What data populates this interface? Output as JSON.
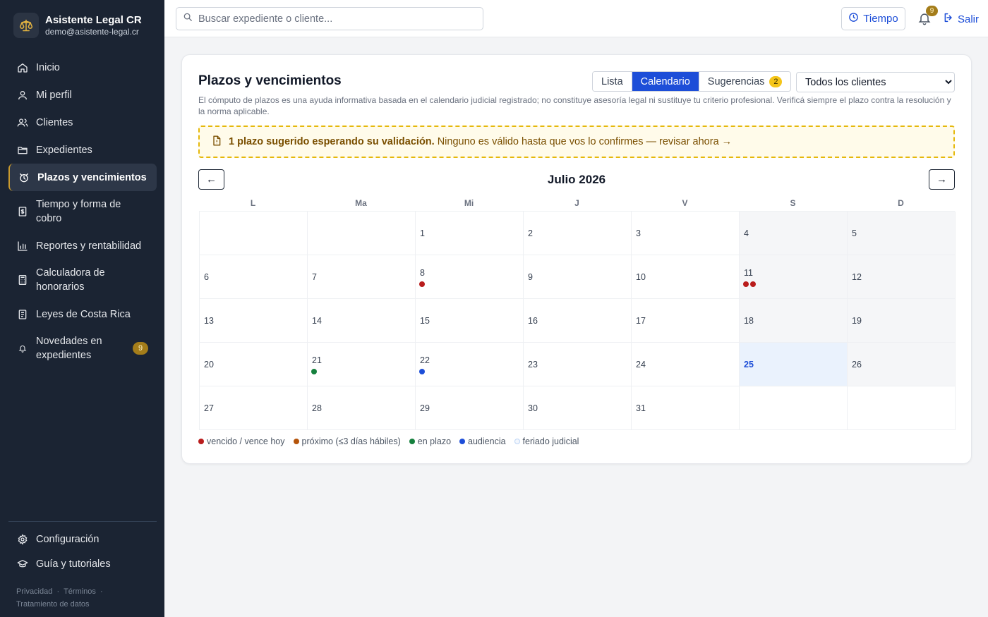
{
  "brand": {
    "title": "Asistente Legal CR",
    "email": "demo@asistente-legal.cr"
  },
  "sidebar": {
    "items": [
      {
        "label": "Inicio",
        "icon": "home-icon"
      },
      {
        "label": "Mi perfil",
        "icon": "user-icon"
      },
      {
        "label": "Clientes",
        "icon": "users-icon"
      },
      {
        "label": "Expedientes",
        "icon": "folder-icon"
      },
      {
        "label": "Plazos y vencimientos",
        "icon": "alarm-clock-icon",
        "active": true
      },
      {
        "label": "Tiempo y forma de cobro",
        "icon": "billing-icon"
      },
      {
        "label": "Reportes y rentabilidad",
        "icon": "bar-chart-icon"
      },
      {
        "label": "Calculadora de honorarios",
        "icon": "calculator-icon"
      },
      {
        "label": "Leyes de Costa Rica",
        "icon": "book-icon"
      },
      {
        "label": "Novedades en expedientes",
        "icon": "bell-icon",
        "badge": "9"
      }
    ],
    "bottom": [
      {
        "label": "Configuración",
        "icon": "gear-icon"
      },
      {
        "label": "Guía y tutoriales",
        "icon": "graduation-cap-icon"
      }
    ],
    "links": {
      "privacy": "Privacidad",
      "terms": "Términos",
      "data": "Tratamiento de datos",
      "sep": "·"
    }
  },
  "topbar": {
    "search_placeholder": "Buscar expediente o cliente...",
    "time_label": "Tiempo",
    "notifications_count": "9",
    "logout_label": "Salir"
  },
  "main": {
    "title": "Plazos y vencimientos",
    "tabs": [
      {
        "label": "Lista",
        "active": false
      },
      {
        "label": "Calendario",
        "active": true
      },
      {
        "label": "Sugerencias",
        "active": false,
        "badge": "2"
      }
    ],
    "client_filter": {
      "selected": "Todos los clientes"
    },
    "disclaimer": "El cómputo de plazos es una ayuda informativa basada en el calendario judicial registrado; no constituye asesoría legal ni sustituye tu criterio profesional. Verificá siempre el plazo contra la resolución y la norma aplicable.",
    "alert": {
      "bold": "1 plazo sugerido esperando su validación.",
      "text": "Ninguno es válido hasta que vos lo confirmes — revisar ahora →"
    },
    "prev_label": "←",
    "next_label": "→"
  },
  "calendar": {
    "month_label": "Julio 2026",
    "weekdays": [
      "L",
      "Ma",
      "Mi",
      "J",
      "V",
      "S",
      "D"
    ],
    "first_weekday_index": 2,
    "days_in_month": 31,
    "today": 25,
    "events": {
      "8": [
        "vencido"
      ],
      "11": [
        "vencido",
        "vencido"
      ],
      "21": [
        "en_plazo"
      ],
      "22": [
        "audiencia"
      ]
    }
  },
  "legend": [
    {
      "key": "vencido",
      "label": "vencido / vence hoy",
      "color": "#b91c1c"
    },
    {
      "key": "proximo",
      "label": "próximo (≤3 días hábiles)",
      "color": "#b45309"
    },
    {
      "key": "en_plazo",
      "label": "en plazo",
      "color": "#15803d"
    },
    {
      "key": "audiencia",
      "label": "audiencia",
      "color": "#1d4ed8"
    },
    {
      "key": "feriado",
      "label": "feriado judicial",
      "color": "#f3f7fd"
    }
  ],
  "colors": {
    "accent": "#1d4ed8",
    "sidebar_bg": "#1b2433",
    "gold": "#a47d1a",
    "alert_border": "#e5b80b"
  }
}
